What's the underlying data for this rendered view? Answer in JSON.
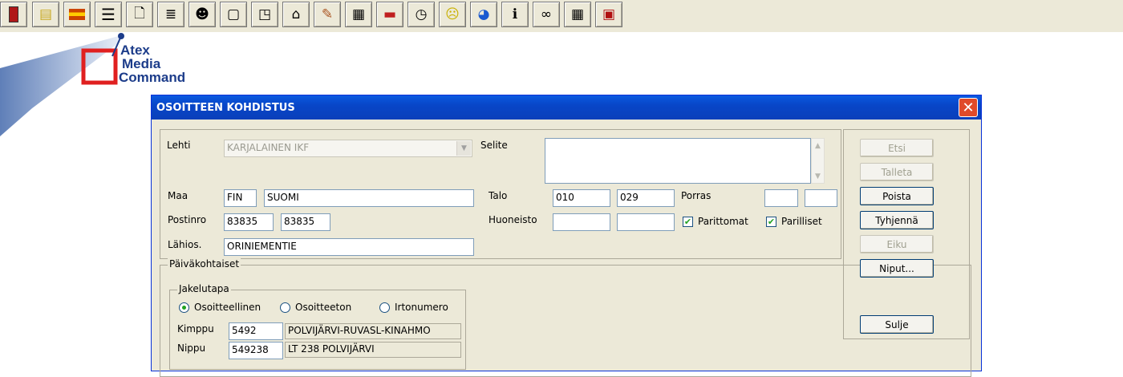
{
  "toolbar": {
    "icons": [
      "exit-icon",
      "folder-icon",
      "flag-icon",
      "menu-bars-icon",
      "page-icon",
      "document-list-icon",
      "mask-icon",
      "blank-page-icon",
      "page-corner-icon",
      "house-icon",
      "pen-tool-icon",
      "calculator-icon",
      "car-icon",
      "clock-icon",
      "sad-face-icon",
      "globe-icon",
      "info-icon",
      "binoculars-icon",
      "grid-icon",
      "calendar-icon"
    ]
  },
  "logo": {
    "line1": "Atex",
    "line2": "Media",
    "line3": "Command"
  },
  "dialog": {
    "title": "OSOITTEEN KOHDISTUS",
    "close_glyph": "✕",
    "lehti_label": "Lehti",
    "lehti_value": "KARJALAINEN   IKF",
    "selite_label": "Selite",
    "selite_value": "",
    "maa_label": "Maa",
    "maa_code": "FIN",
    "maa_name": "SUOMI",
    "postinro_label": "Postinro",
    "postinro_1": "83835",
    "postinro_2": "83835",
    "lahios_label": "Lähios.",
    "lahios_value": "ORINIEMENTIE",
    "talo_label": "Talo",
    "talo_1": "010",
    "talo_2": "029",
    "porras_label": "Porras",
    "porras_1": "",
    "porras_2": "",
    "huoneisto_label": "Huoneisto",
    "huoneisto_1": "",
    "huoneisto_2": "",
    "parittomat_label": "Parittomat",
    "parittomat_checked": true,
    "parilliset_label": "Parilliset",
    "parilliset_checked": true,
    "paivakohtaiset_label": "Päiväkohtaiset",
    "jakelutapa_label": "Jakelutapa",
    "radio_osoitteellinen": "Osoitteellinen",
    "radio_osoitteeton": "Osoitteeton",
    "radio_irtonumero": "Irtonumero",
    "selected_jakelutapa": "Osoitteellinen",
    "kimppu_label": "Kimppu",
    "kimppu_code": "5492",
    "kimppu_name": "POLVIJÄRVI-RUVASL-KINAHMO",
    "nippu_label": "Nippu",
    "nippu_code": "549238",
    "nippu_name": "LT 238  POLVIJÄRVI",
    "buttons": {
      "etsi": "Etsi",
      "talleta": "Talleta",
      "poista": "Poista",
      "tyhjenna": "Tyhjennä",
      "eiku": "Eiku",
      "niput": "Niput...",
      "sulje": "Sulje"
    }
  }
}
